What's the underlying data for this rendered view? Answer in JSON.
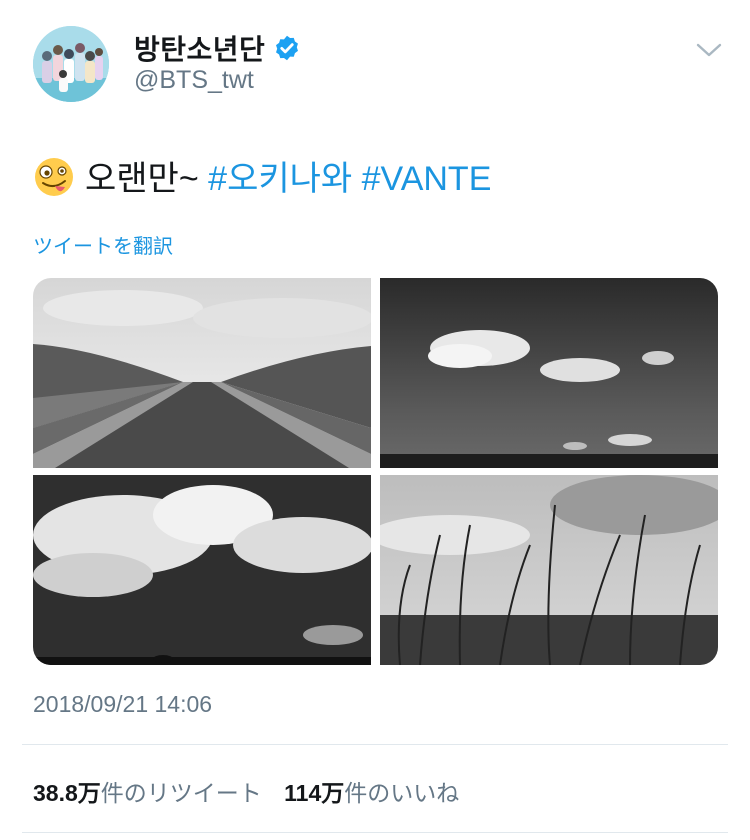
{
  "header": {
    "display_name": "방탄소년단",
    "handle": "@BTS_twt",
    "verified": true
  },
  "tweet": {
    "text": "오랜만~",
    "hashtags": [
      "#오키나와",
      "#VANTE"
    ],
    "emoji": "zany-face-emoji",
    "translate_label": "ツイートを翻訳",
    "timestamp": "2018/09/21 14:06"
  },
  "media": {
    "photos": [
      {
        "description": "black and white road through grassy fields"
      },
      {
        "description": "black and white clouds over the sea"
      },
      {
        "description": "black and white cumulus clouds sky"
      },
      {
        "description": "black and white tall grass against sky"
      }
    ]
  },
  "stats": {
    "retweets": {
      "count": "38.8万",
      "label": "件のリツイート"
    },
    "likes": {
      "count": "114万",
      "label": "件のいいね"
    }
  },
  "icons": {
    "verified": "verified-badge-icon",
    "menu": "chevron-down-icon"
  },
  "colors": {
    "link": "#1b95e0",
    "secondary_text": "#657786",
    "verified": "#1da1f2"
  }
}
